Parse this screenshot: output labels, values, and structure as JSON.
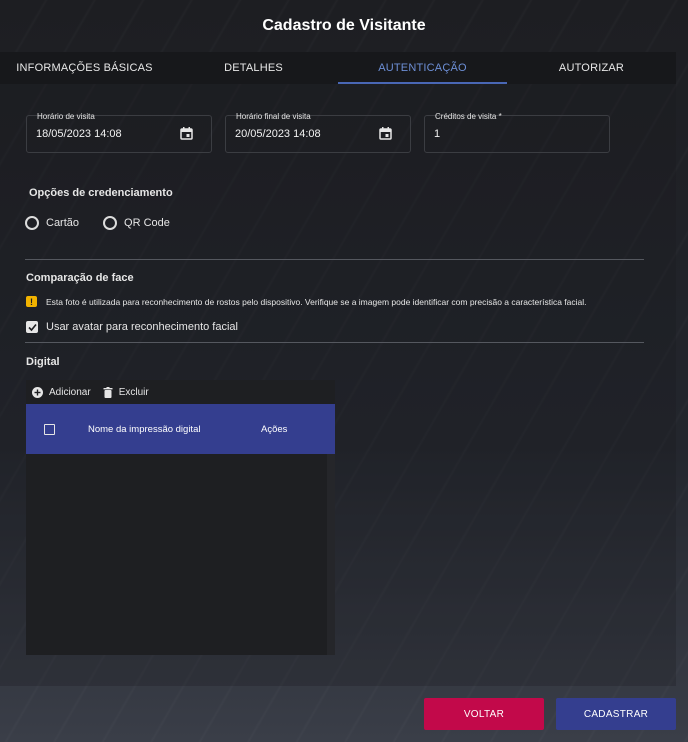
{
  "header": {
    "title": "Cadastro de Visitante"
  },
  "tabs": [
    {
      "label": "INFORMAÇÕES BÁSICAS",
      "active": false
    },
    {
      "label": "DETALHES",
      "active": false
    },
    {
      "label": "AUTENTICAÇÃO",
      "active": true
    },
    {
      "label": "AUTORIZAR",
      "active": false
    }
  ],
  "fields": {
    "visit_start": {
      "label": "Horário de visita",
      "value": "18/05/2023 14:08",
      "icon": "calendar-icon"
    },
    "visit_end": {
      "label": "Horário final de visita",
      "value": "20/05/2023 14:08",
      "icon": "calendar-icon"
    },
    "visit_credits": {
      "label": "Créditos de visita *",
      "value": "1"
    }
  },
  "credentialing": {
    "title": "Opções de credenciamento",
    "options": [
      {
        "label": "Cartão",
        "selected": false
      },
      {
        "label": "QR Code",
        "selected": false
      }
    ]
  },
  "face": {
    "title": "Comparação de face",
    "warning_icon": "warning-icon",
    "warning_text": "Esta foto é utilizada para reconhecimento de rostos pelo dispositivo. Verifique se a imagem pode identificar com precisão a característica facial.",
    "avatar_checkbox": {
      "label": "Usar avatar para reconhecimento facial",
      "checked": true
    }
  },
  "digital": {
    "title": "Digital",
    "toolbar": {
      "add_label": "Adicionar",
      "delete_label": "Excluir"
    },
    "columns": [
      "Nome da impressão digital",
      "Ações"
    ],
    "rows": []
  },
  "footer": {
    "back_label": "VOLTAR",
    "save_label": "CADASTRAR"
  },
  "colors": {
    "accent": "#343e8f",
    "active_tab": "#6d8fd6",
    "back_button": "#c2094a",
    "warning": "#f2b300"
  }
}
